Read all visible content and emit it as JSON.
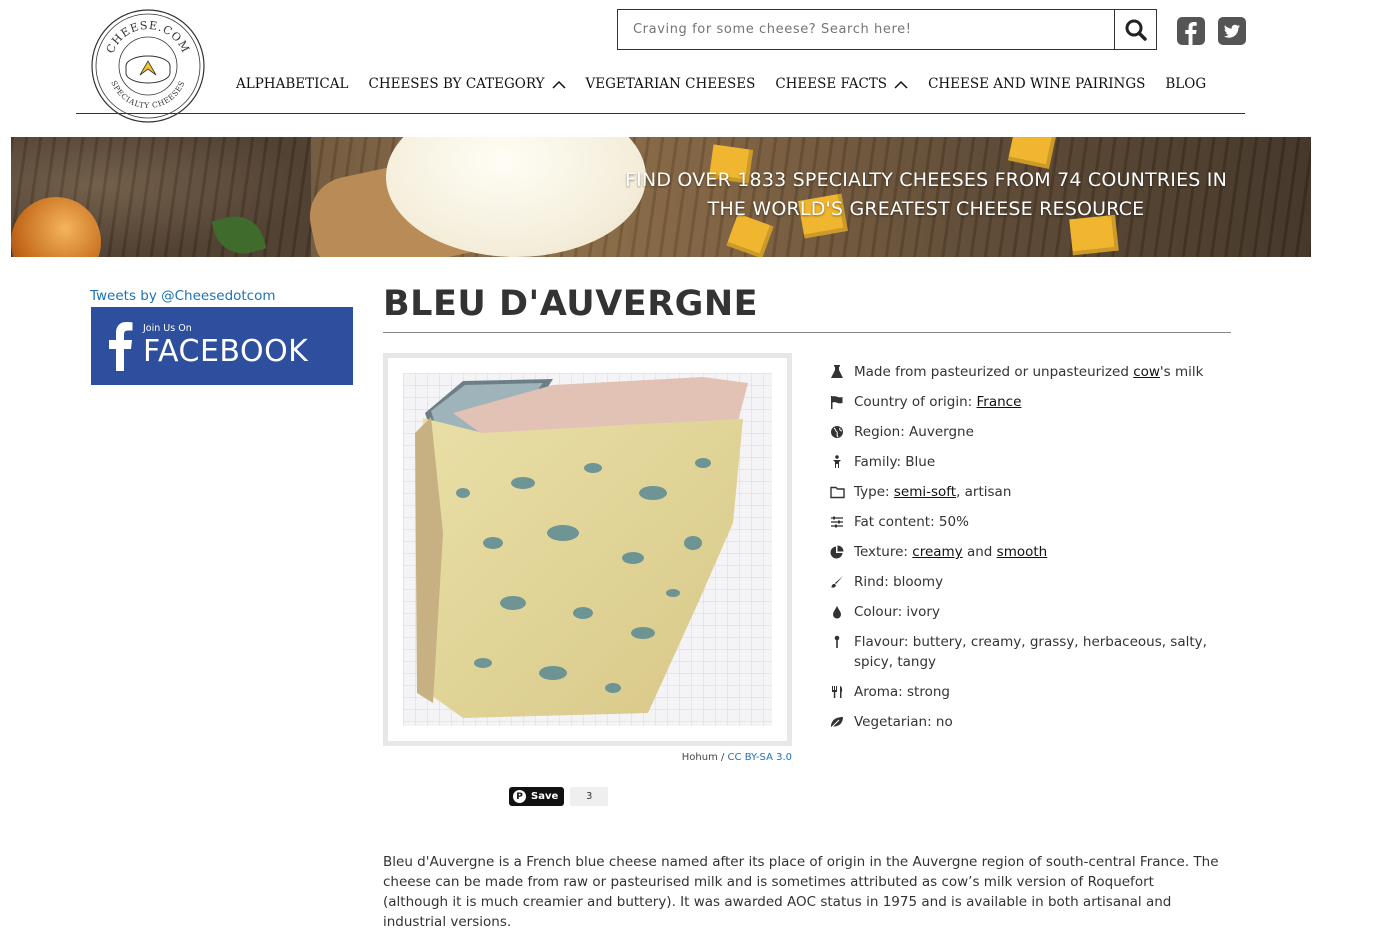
{
  "header": {
    "logo": {
      "text_top": "CHEESE.COM",
      "text_bottom": "SPECIALTY CHEESES"
    },
    "search": {
      "placeholder": "Craving for some cheese? Search here!"
    },
    "social": [
      {
        "icon": "facebook-icon"
      },
      {
        "icon": "twitter-icon"
      }
    ],
    "nav": [
      {
        "label": "ALPHABETICAL",
        "dropdown": false
      },
      {
        "label": "CHEESES BY CATEGORY",
        "dropdown": true
      },
      {
        "label": "VEGETARIAN CHEESES",
        "dropdown": false
      },
      {
        "label": "CHEESE FACTS",
        "dropdown": true
      },
      {
        "label": "CHEESE AND WINE PAIRINGS",
        "dropdown": false
      },
      {
        "label": "BLOG",
        "dropdown": false
      }
    ]
  },
  "banner": {
    "line1": "FIND OVER 1833 SPECIALTY CHEESES FROM 74 COUNTRIES IN",
    "line2": "THE WORLD'S GREATEST CHEESE RESOURCE"
  },
  "sidebar": {
    "tweets_link": "Tweets by @Cheesedotcom",
    "facebook_box": {
      "join": "Join Us On",
      "word": "FACEBOOK"
    }
  },
  "cheese": {
    "name": "BLEU D'AUVERGNE",
    "image_credit": {
      "author": "Hohum / ",
      "license": "CC BY-SA 3.0"
    },
    "pin": {
      "label": "Save",
      "count": "3"
    },
    "facts": {
      "milk": {
        "pre": "Made from pasteurized or unpasteurized ",
        "link": "cow",
        "post": "'s milk"
      },
      "country": {
        "pre": "Country of origin: ",
        "link": "France"
      },
      "region": "Region: Auvergne",
      "family": "Family: Blue",
      "type": {
        "pre": "Type: ",
        "link": "semi-soft",
        "post": ", artisan"
      },
      "fat": "Fat content: 50%",
      "texture": {
        "pre": "Texture: ",
        "link1": "creamy",
        "mid": " and ",
        "link2": "smooth"
      },
      "rind": "Rind: bloomy",
      "colour": "Colour: ivory",
      "flavour": "Flavour: buttery, creamy, grassy, herbaceous, salty, spicy, tangy",
      "aroma": "Aroma: strong",
      "vegetarian": "Vegetarian: no"
    },
    "description": "Bleu d'Auvergne is a French blue cheese named after its place of origin in the Auvergne region of south-central France. The cheese can be made from raw or pasteurised milk and is sometimes attributed as cow’s milk version of Roquefort (although it is much creamier and buttery). It was awarded AOC status in 1975 and is available in both artisanal and industrial versions."
  },
  "colors": {
    "link_blue": "#1e72b5",
    "facebook_blue": "#2d4f9e",
    "text": "#333333",
    "logo_gold": "#f2c230"
  }
}
